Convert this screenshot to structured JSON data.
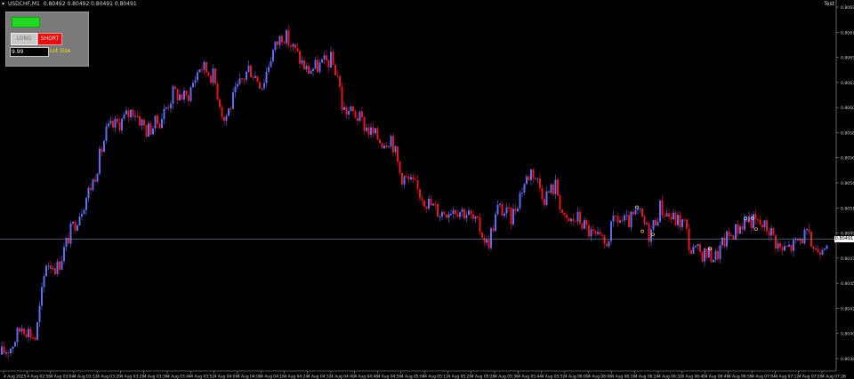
{
  "header": {
    "symbol": "USDCHF,M1",
    "ohlc": "0.80492 0.80492 0.80491 0.80491",
    "expert_label": "Test"
  },
  "panel": {
    "long_label": "LONG",
    "short_label": "SHORT",
    "lot_value": "9.99",
    "lot_label": "Lot Size"
  },
  "colors": {
    "background": "#000000",
    "bull": "#5b6ef0",
    "bear": "#e8141e",
    "grid_text": "#cfcfcf",
    "bid_line": "#7f8fa8"
  },
  "current_price": "0.80491",
  "chart_data": {
    "type": "candlestick",
    "price_axis_ticks": [
      "0.80695",
      "0.80675",
      "0.80650",
      "0.80630",
      "0.80605",
      "0.80585",
      "0.80560",
      "0.80540",
      "0.80515",
      "0.80495",
      "0.80470",
      "0.80450",
      "0.80425",
      "0.80405",
      "0.80380"
    ],
    "time_axis_ticks": [
      "4 Aug 2025",
      "4 Aug 02:56",
      "4 Aug 03:04",
      "4 Aug 03:12",
      "4 Aug 03:20",
      "4 Aug 03:28",
      "4 Aug 03:36",
      "4 Aug 03:44",
      "4 Aug 03:52",
      "4 Aug 04:00",
      "4 Aug 04:08",
      "4 Aug 04:16",
      "4 Aug 04:24",
      "4 Aug 04:32",
      "4 Aug 04:40",
      "4 Aug 04:48",
      "4 Aug 04:56",
      "4 Aug 05:04",
      "4 Aug 05:12",
      "4 Aug 05:20",
      "4 Aug 05:28",
      "4 Aug 05:36",
      "4 Aug 05:44",
      "4 Aug 05:52",
      "4 Aug 06:00",
      "4 Aug 06:08",
      "4 Aug 06:16",
      "4 Aug 06:24",
      "4 Aug 06:32",
      "4 Aug 06:40",
      "4 Aug 06:48",
      "4 Aug 06:56",
      "4 Aug 07:04",
      "4 Aug 07:12",
      "4 Aug 07:20",
      "4 Aug 07:28"
    ],
    "close_path": [
      [
        0,
        0.80385
      ],
      [
        12,
        0.80392
      ],
      [
        25,
        0.80412
      ],
      [
        40,
        0.804
      ],
      [
        52,
        0.8047
      ],
      [
        65,
        0.80465
      ],
      [
        78,
        0.80495
      ],
      [
        92,
        0.8052
      ],
      [
        105,
        0.80545
      ],
      [
        120,
        0.8059
      ],
      [
        138,
        0.806
      ],
      [
        150,
        0.8061
      ],
      [
        165,
        0.8059
      ],
      [
        180,
        0.806
      ],
      [
        195,
        0.80625
      ],
      [
        210,
        0.8062
      ],
      [
        225,
        0.8065
      ],
      [
        240,
        0.8064
      ],
      [
        252,
        0.806
      ],
      [
        268,
        0.8063
      ],
      [
        280,
        0.80648
      ],
      [
        295,
        0.80632
      ],
      [
        305,
        0.8066
      ],
      [
        318,
        0.8068
      ],
      [
        330,
        0.80665
      ],
      [
        345,
        0.80645
      ],
      [
        360,
        0.8065
      ],
      [
        372,
        0.80655
      ],
      [
        380,
        0.8064
      ],
      [
        385,
        0.8061
      ],
      [
        400,
        0.80605
      ],
      [
        415,
        0.8059
      ],
      [
        430,
        0.8058
      ],
      [
        440,
        0.80585
      ],
      [
        450,
        0.8055
      ],
      [
        465,
        0.8054
      ],
      [
        480,
        0.80525
      ],
      [
        495,
        0.80515
      ],
      [
        510,
        0.8052
      ],
      [
        525,
        0.80515
      ],
      [
        540,
        0.805
      ],
      [
        548,
        0.80485
      ],
      [
        560,
        0.8052
      ],
      [
        575,
        0.8051
      ],
      [
        588,
        0.8054
      ],
      [
        598,
        0.80555
      ],
      [
        612,
        0.8053
      ],
      [
        625,
        0.8054
      ],
      [
        635,
        0.80505
      ],
      [
        650,
        0.8051
      ],
      [
        665,
        0.80495
      ],
      [
        680,
        0.80485
      ],
      [
        692,
        0.8051
      ],
      [
        705,
        0.80505
      ],
      [
        718,
        0.80515
      ],
      [
        730,
        0.80495
      ],
      [
        742,
        0.8052
      ],
      [
        755,
        0.8051
      ],
      [
        770,
        0.80505
      ],
      [
        776,
        0.8048
      ],
      [
        790,
        0.80478
      ],
      [
        805,
        0.80475
      ],
      [
        815,
        0.8049
      ],
      [
        828,
        0.805
      ],
      [
        840,
        0.8051
      ],
      [
        852,
        0.80505
      ],
      [
        865,
        0.805
      ],
      [
        878,
        0.8048
      ],
      [
        892,
        0.80485
      ],
      [
        905,
        0.80495
      ],
      [
        918,
        0.8048
      ],
      [
        928,
        0.80491
      ]
    ],
    "signal_markers": [
      {
        "i": 716,
        "p": 0.8052,
        "color": "#b8e0c8"
      },
      {
        "i": 722,
        "p": 0.80498,
        "color": "#e8a060"
      },
      {
        "i": 734,
        "p": 0.80495,
        "color": "#e8c860"
      },
      {
        "i": 798,
        "p": 0.80482,
        "color": "#d0f0a0"
      },
      {
        "i": 838,
        "p": 0.8051,
        "color": "#a0e0ff"
      },
      {
        "i": 846,
        "p": 0.8051,
        "color": "#a0e0ff"
      },
      {
        "i": 850,
        "p": 0.805,
        "color": "#e8a060"
      }
    ]
  }
}
